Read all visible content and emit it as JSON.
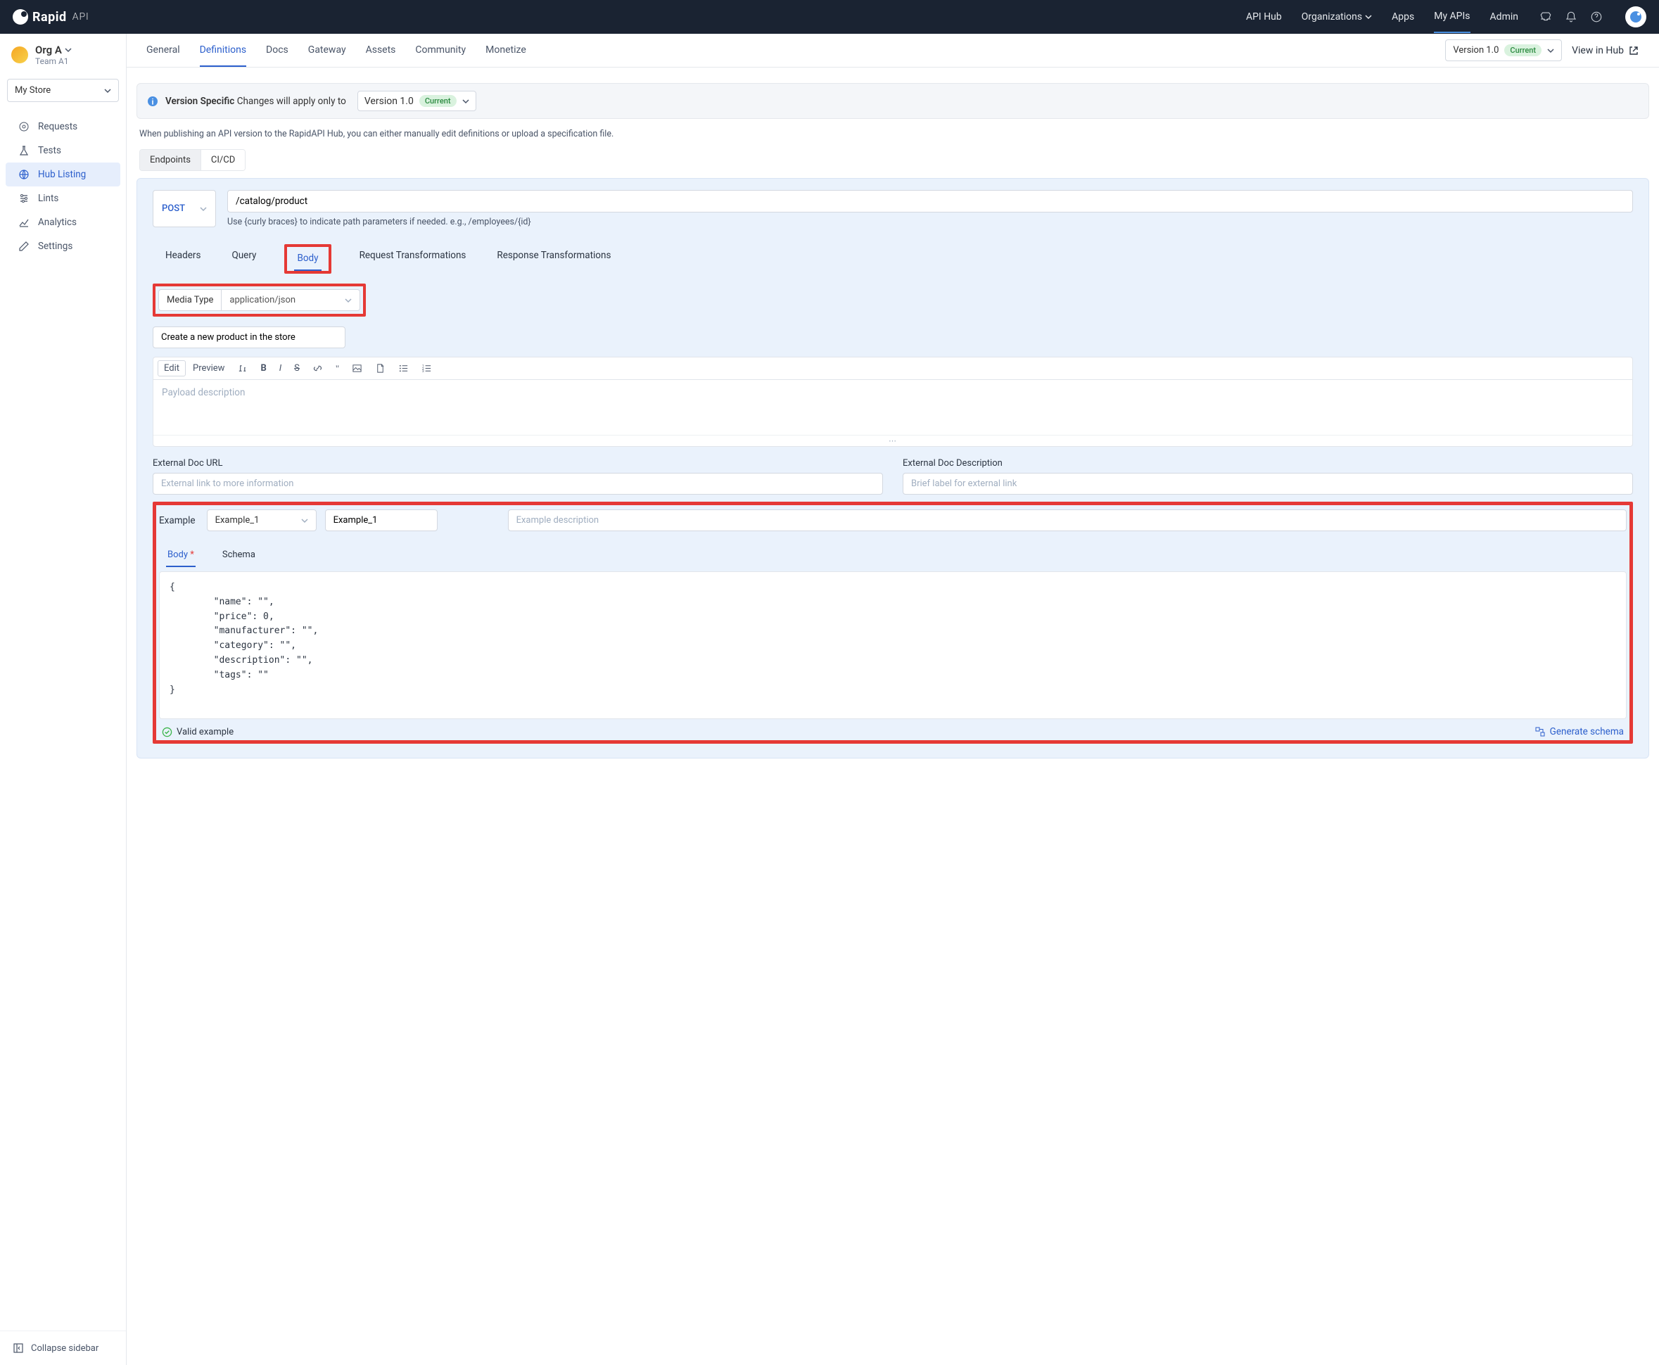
{
  "header": {
    "brand": "Rapid",
    "brand_suffix": "API",
    "nav": {
      "api_hub": "API Hub",
      "organizations": "Organizations",
      "apps": "Apps",
      "my_apis": "My APIs",
      "admin": "Admin"
    }
  },
  "sidebar": {
    "org_name": "Org A",
    "team": "Team A1",
    "store_label": "My Store",
    "items": {
      "requests": "Requests",
      "tests": "Tests",
      "hub_listing": "Hub Listing",
      "lints": "Lints",
      "analytics": "Analytics",
      "settings": "Settings"
    },
    "collapse": "Collapse sidebar"
  },
  "main_tabs": {
    "general": "General",
    "definitions": "Definitions",
    "docs": "Docs",
    "gateway": "Gateway",
    "assets": "Assets",
    "community": "Community",
    "monetize": "Monetize"
  },
  "version": {
    "label": "Version 1.0",
    "badge": "Current",
    "view_hub": "View in Hub"
  },
  "banner": {
    "strong": "Version Specific",
    "text": "Changes will apply only to",
    "sel_label": "Version 1.0",
    "sel_badge": "Current"
  },
  "subdesc": "When publishing an API version to the RapidAPI Hub, you can either manually edit definitions or upload a specification file.",
  "pills": {
    "endpoints": "Endpoints",
    "cicd": "CI/CD"
  },
  "endpoint": {
    "method": "POST",
    "path": "/catalog/product",
    "hint": "Use {curly braces} to indicate path parameters if needed. e.g., /employees/{id}",
    "tabs": {
      "headers": "Headers",
      "query": "Query",
      "body": "Body",
      "req_trans": "Request Transformations",
      "res_trans": "Response Transformations"
    },
    "media_type_label": "Media Type",
    "media_type_value": "application/json",
    "short_desc": "Create a new product in the store",
    "editor": {
      "edit": "Edit",
      "preview": "Preview",
      "placeholder": "Payload description"
    },
    "ext_url_label": "External Doc URL",
    "ext_url_placeholder": "External link to more information",
    "ext_desc_label": "External Doc Description",
    "ext_desc_placeholder": "Brief label for external link",
    "example_label": "Example",
    "example_select": "Example_1",
    "example_name": "Example_1",
    "example_desc_placeholder": "Example description",
    "bs_tabs": {
      "body": "Body",
      "schema": "Schema"
    },
    "code": "{\n        \"name\": \"\",\n        \"price\": 0,\n        \"manufacturer\": \"\",\n        \"category\": \"\",\n        \"description\": \"\",\n        \"tags\": \"\"\n}",
    "valid": "Valid example",
    "gen_schema": "Generate schema"
  }
}
